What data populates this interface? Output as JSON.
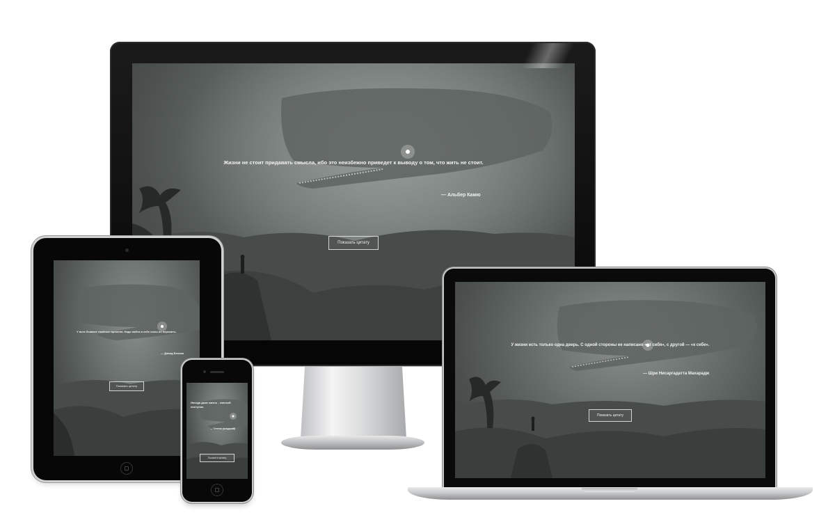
{
  "devices": {
    "monitor": {
      "quote": "Жизни не стоит придавать смысла, ибо это неизбежно приведет к выводу о том, что жить не стоит.",
      "author": "— Альбер Камю",
      "button_label": "Показать цитату"
    },
    "tablet": {
      "quote": "У всех бывают тяжёлые времена. Надо найти в себе силы их пережить.",
      "author": "— Дэвид Бекхэм",
      "button_label": "Показать цитату"
    },
    "phone": {
      "quote": "Иногда даже жизнь - смелый поступок.",
      "author": "— Сенека (младший)",
      "button_label": "Показать цитату"
    },
    "laptop": {
      "quote": "У жизни есть только одна дверь. С одной стороны ее написано «от себя», с другой — «к себе».",
      "author": "— Шри Нисаргадатта Махарадж",
      "button_label": "Показать цитату"
    }
  },
  "colors": {
    "text": "#f2f2f2",
    "scene_light": "#8a8f8c",
    "scene_dark": "#3a3e3c",
    "device_black": "#070707",
    "aluminium": "#c8c9cb"
  }
}
